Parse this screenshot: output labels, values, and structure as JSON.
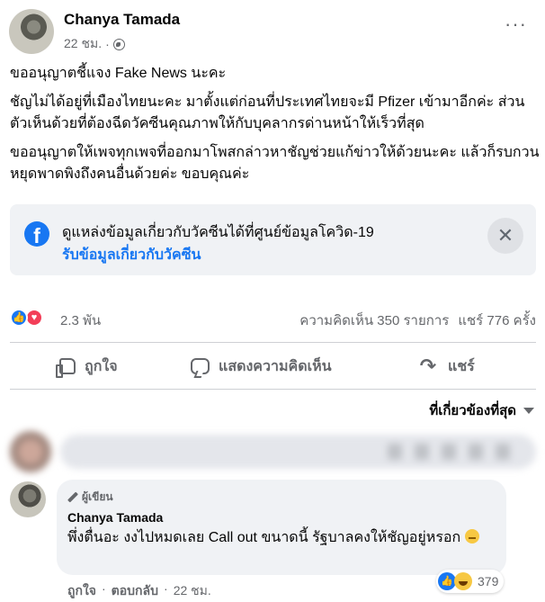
{
  "post": {
    "author": "Chanya Tamada",
    "time": "22 ชม.",
    "separator": "·",
    "more": "···",
    "paragraphs": [
      "ขออนุญาตชี้แจง Fake News นะคะ",
      "ชัญไม่ได้อยู่ที่เมืองไทยนะคะ มาตั้งแต่ก่อนที่ประเทศไทยจะมี Pfizer เข้ามาอีกค่ะ ส่วนตัวเห็นด้วยที่ต้องฉีดวัคซีนคุณภาพให้กับบุคลากรด่านหน้าให้เร็วที่สุด",
      "ขออนุญาตให้เพจทุกเพจที่ออกมาโพสกล่าวหาชัญช่วยแก้ข่าวให้ด้วยนะคะ แล้วก็รบกวนหยุดพาดพิงถึงคนอื่นด้วยค่ะ ขอบคุณค่ะ"
    ]
  },
  "info_box": {
    "logo": "f",
    "title": "ดูแหล่งข้อมูลเกี่ยวกับวัคซีนได้ที่ศูนย์ข้อมูลโควิด-19",
    "link": "รับข้อมูลเกี่ยวกับวัคซีน",
    "close": "✕"
  },
  "stats": {
    "reactions": "2.3 พัน",
    "comments": "ความคิดเห็น 350 รายการ",
    "shares": "แชร์ 776 ครั้ง"
  },
  "actions": {
    "like": "ถูกใจ",
    "comment": "แสดงความคิดเห็น",
    "share": "แชร์"
  },
  "sort": {
    "label": "ที่เกี่ยวข้องที่สุด"
  },
  "comment": {
    "badge": "ผู้เขียน",
    "author": "Chanya Tamada",
    "text": "พึ่งตื่นอะ งงไปหมดเลย Call out ขนาดนี้ รัฐบาลคงให้ชัญอยู่หรอก",
    "reaction_count": "379",
    "like": "ถูกใจ",
    "dot": "·",
    "reply": "ตอบกลับ",
    "time": "22 ชม."
  },
  "icons": {
    "like_glyph": "👍",
    "love_glyph": "♥",
    "share_glyph": "↷"
  },
  "colors": {
    "accent": "#1877f2",
    "love": "#f33e58",
    "muted": "#65676b",
    "bubble": "#f0f2f5"
  }
}
